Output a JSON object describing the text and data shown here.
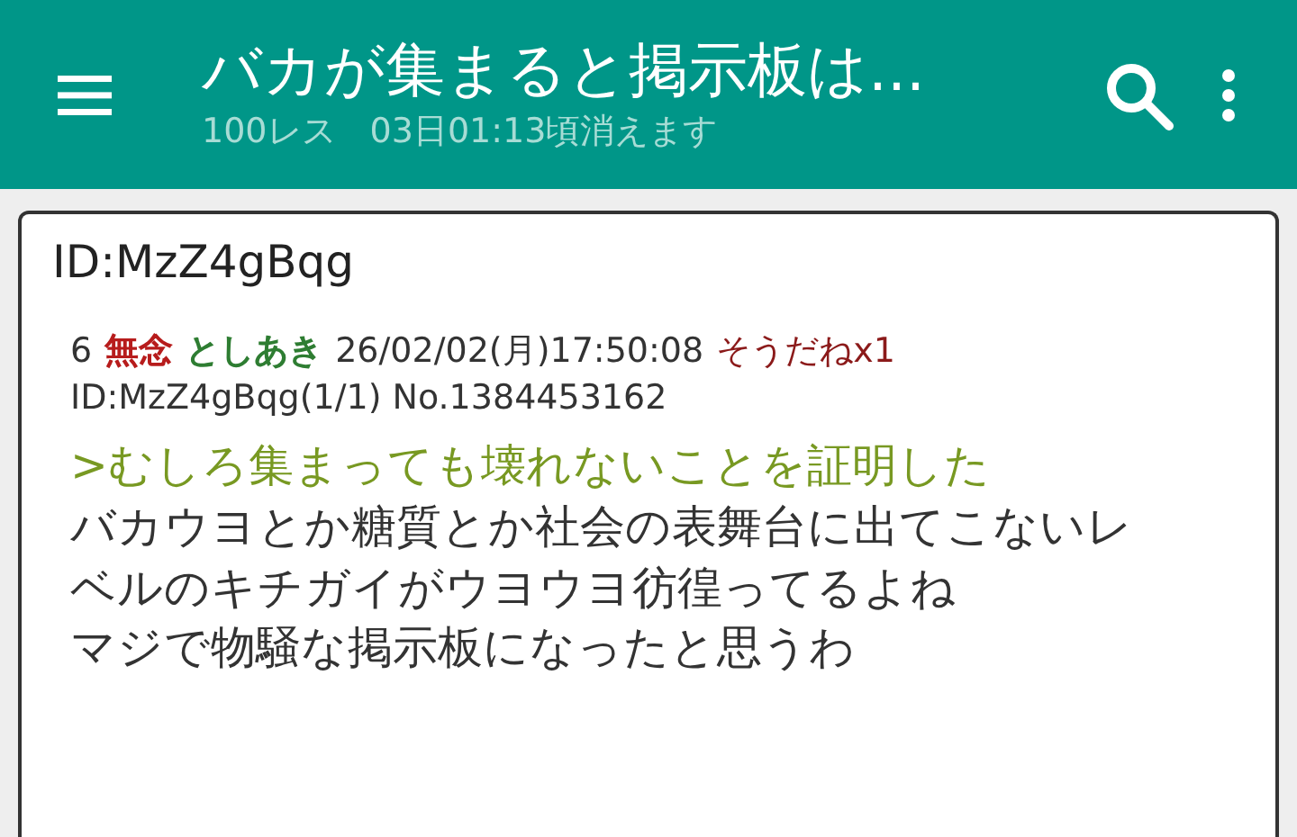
{
  "app_bar": {
    "title": "バカが集まると掲示板は...",
    "subtitle": "100レス　03日01:13頃消えます"
  },
  "popup": {
    "title": "ID:MzZ4gBqg",
    "post": {
      "number": "6",
      "subject": "無念",
      "name": "としあき",
      "date": "26/02/02(月)17:50:08",
      "likes": "そうだねx1",
      "id_line": "ID:MzZ4gBqg(1/1) No.1384453162",
      "lines": [
        {
          "kind": "quote",
          "text": ">むしろ集まっても壊れないことを証明した"
        },
        {
          "kind": "text",
          "text": "バカウヨとか糖質とか社会の表舞台に出てこないレ"
        },
        {
          "kind": "text",
          "text": "ベルのキチガイがウヨウヨ彷徨ってるよね"
        },
        {
          "kind": "text",
          "text": "マジで物騒な掲示板になったと思うわ"
        }
      ]
    }
  }
}
